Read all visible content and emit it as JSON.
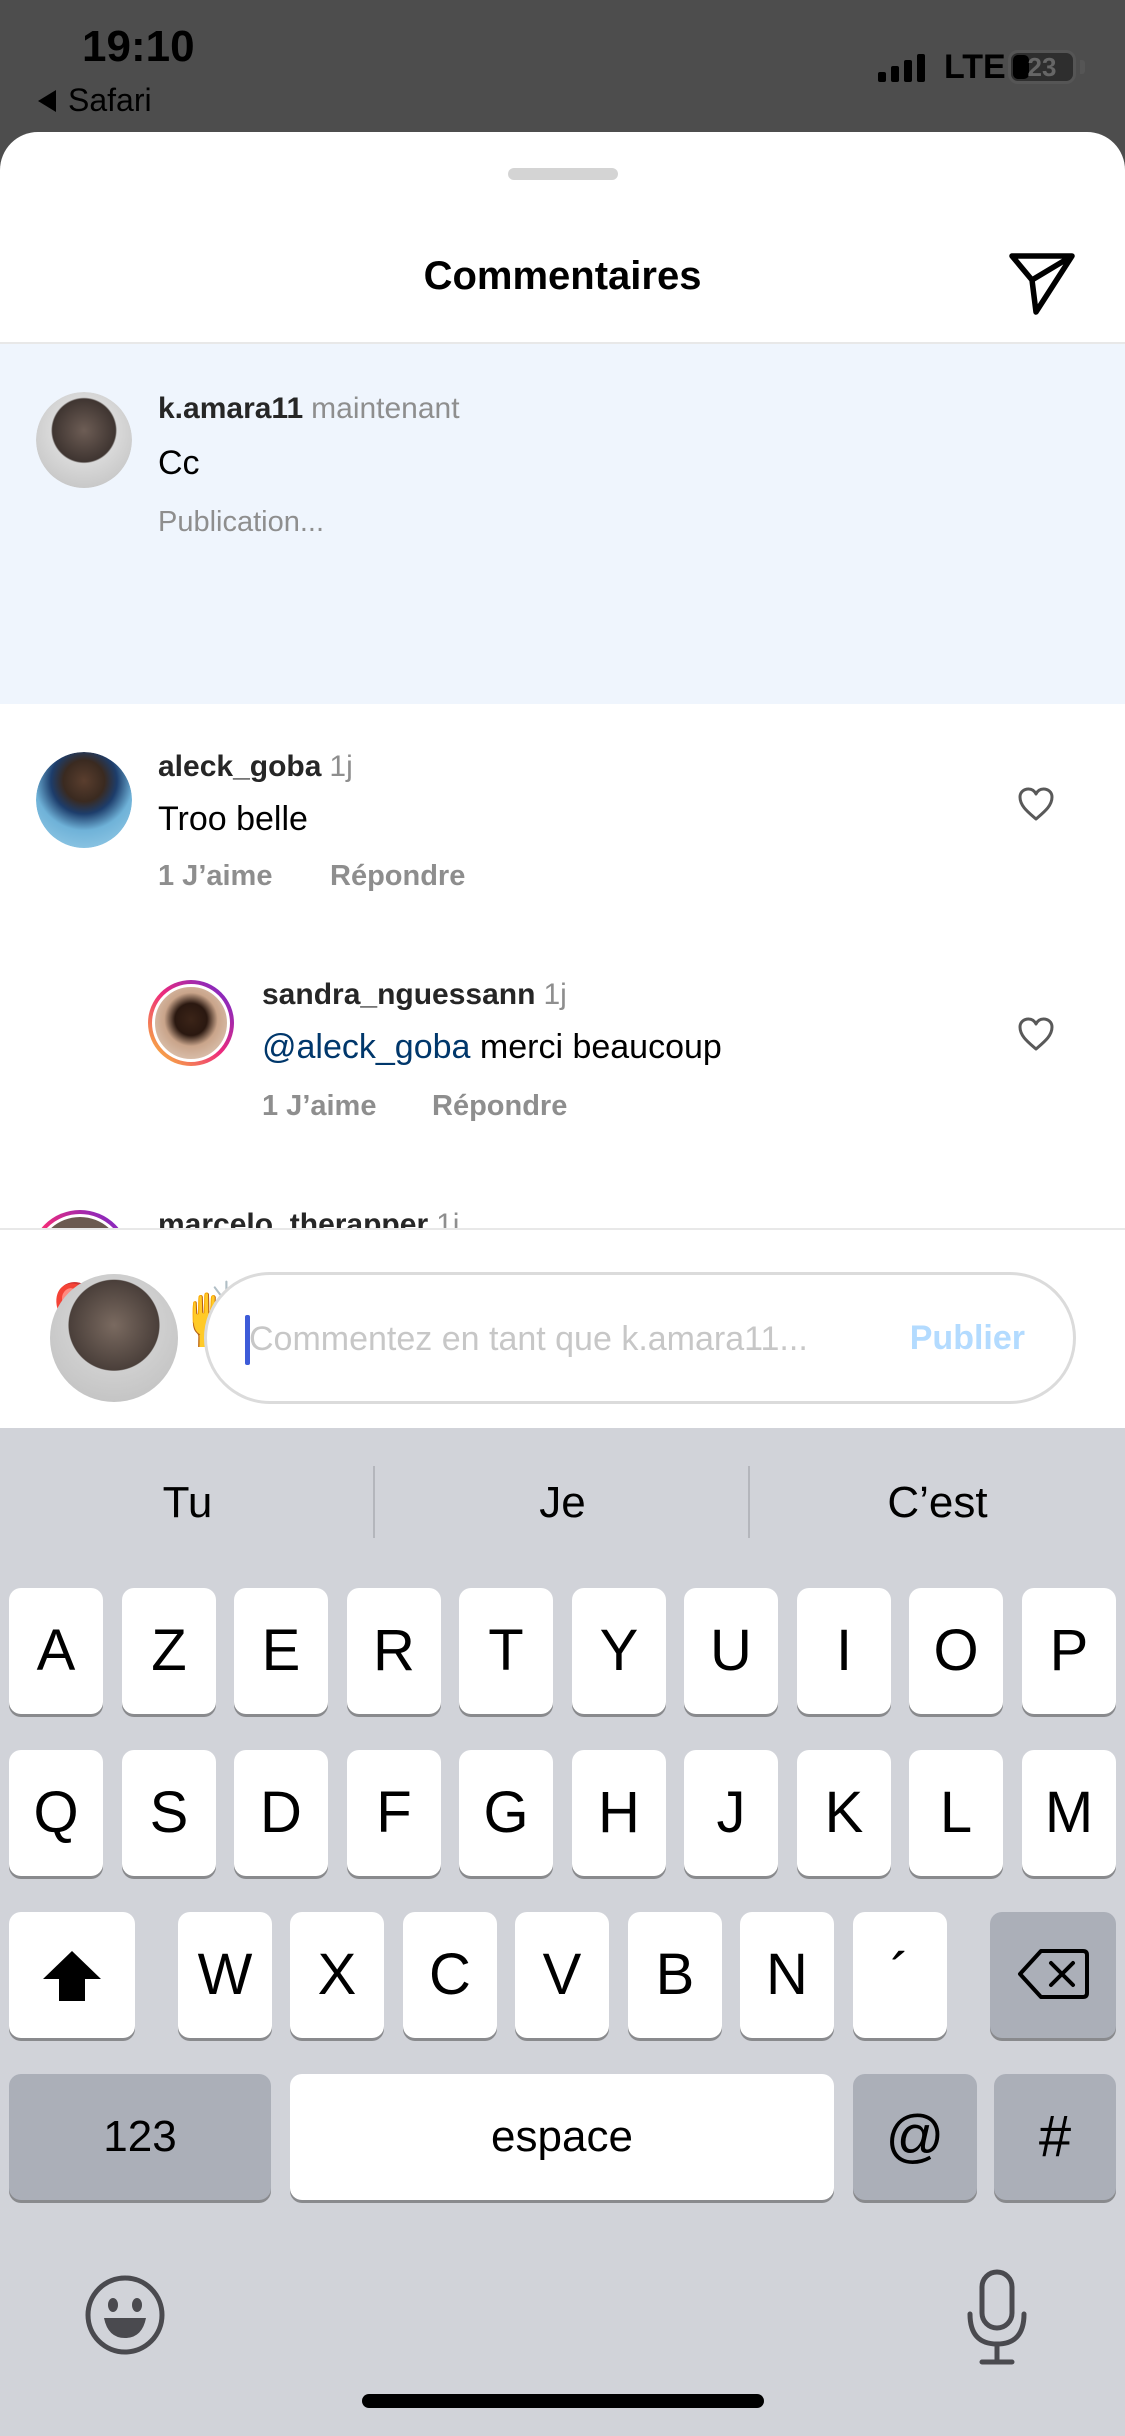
{
  "status_bar": {
    "time": "19:10",
    "back_app": "Safari",
    "network": "LTE",
    "battery": "23"
  },
  "sheet": {
    "title": "Commentaires",
    "share_icon": "paper-plane-icon"
  },
  "comments": [
    {
      "username": "k.amara11",
      "time": "maintenant",
      "text": "Cc",
      "status": "Publication..."
    },
    {
      "username": "aleck_goba",
      "time": "1j",
      "text": "Troo belle",
      "likes": "1 J’aime",
      "reply": "Répondre"
    },
    {
      "username": "sandra_nguessann",
      "time": "1j",
      "mention": "@aleck_goba",
      "text": " merci beaucoup",
      "likes": "1 J’aime",
      "reply": "Répondre"
    },
    {
      "username": "marcelo_therapper",
      "time": "1j"
    }
  ],
  "reactions": [
    "❤️",
    "🙌",
    "🔥",
    "👏",
    "😢",
    "😍",
    "😮",
    "😂"
  ],
  "composer": {
    "placeholder": "Commentez en tant que k.amara11...",
    "publish_label": "Publier"
  },
  "keyboard": {
    "predictions": [
      "Tu",
      "Je",
      "C’est"
    ],
    "row1": [
      "A",
      "Z",
      "E",
      "R",
      "T",
      "Y",
      "U",
      "I",
      "O",
      "P"
    ],
    "row2": [
      "Q",
      "S",
      "D",
      "F",
      "G",
      "H",
      "J",
      "K",
      "L",
      "M"
    ],
    "row3": [
      "W",
      "X",
      "C",
      "V",
      "B",
      "N",
      "´"
    ],
    "numbers_label": "123",
    "space_label": "espace",
    "at_label": "@",
    "hash_label": "#"
  },
  "colors": {
    "highlight": "#eff5fd",
    "mention": "#00376b",
    "publish": "#b3dbff",
    "heart_reaction": "#ed1c24"
  }
}
